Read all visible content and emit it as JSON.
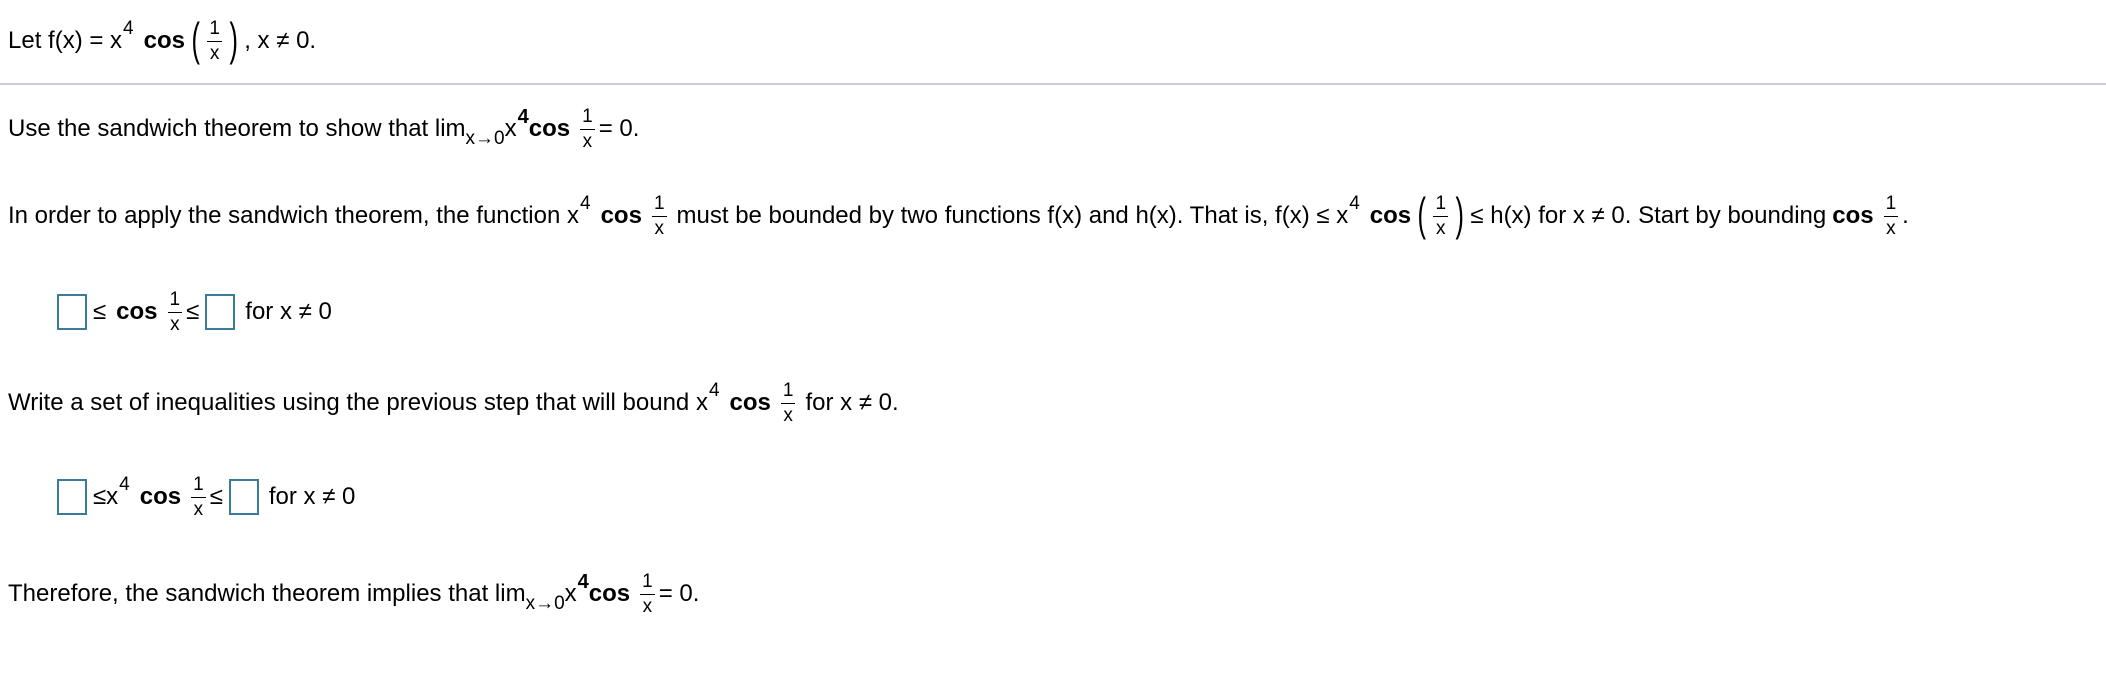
{
  "header": {
    "intro": "Let f(x) = x",
    "exp": "4",
    "cos": "cos",
    "frac_num": "1",
    "frac_den": "x",
    "paren_left": "(",
    "paren_right": ")",
    "tail": ", x ≠ 0."
  },
  "q1": {
    "text": "Use the sandwich theorem to show that lim",
    "lim_sub": "x→0",
    "x": "x",
    "exp": "4",
    "cos": "cos",
    "frac_num": "1",
    "frac_den": "x",
    "tail": "= 0."
  },
  "q2": {
    "text_a": "In order to apply the sandwich theorem, the function x",
    "exp": "4",
    "cos": "cos",
    "frac_num": "1",
    "frac_den": "x",
    "text_b": "must be bounded by two functions f(x) and h(x). That is, f(x) ≤ x",
    "exp2": "4",
    "cos2": "cos",
    "paren_left": "(",
    "paren_right": ")",
    "text_c": "≤ h(x) for x ≠ 0. Start by bounding",
    "cos3": "cos",
    "tail": "."
  },
  "step1": {
    "le1": "≤",
    "cos": "cos",
    "frac_num": "1",
    "frac_den": "x",
    "le2": "≤",
    "condition": "for x ≠ 0",
    "lower_value": "",
    "upper_value": ""
  },
  "q3": {
    "text": "Write a set of inequalities using the previous step that will bound x",
    "exp": "4",
    "cos": "cos",
    "frac_num": "1",
    "frac_den": "x",
    "tail": "for x ≠ 0."
  },
  "step2": {
    "le1": "≤",
    "x": "x",
    "exp": "4",
    "cos": "cos",
    "frac_num": "1",
    "frac_den": "x",
    "le2": "≤",
    "condition": "for x ≠ 0",
    "lower_value": "",
    "upper_value": ""
  },
  "conclusion": {
    "text": "Therefore, the sandwich theorem implies that lim",
    "lim_sub": "x→0",
    "x": "x",
    "exp": "4",
    "cos": "cos",
    "frac_num": "1",
    "frac_den": "x",
    "tail": "= 0."
  },
  "colors": {
    "input_border": "#3a7a9c",
    "divider": "#c9ccd8"
  }
}
